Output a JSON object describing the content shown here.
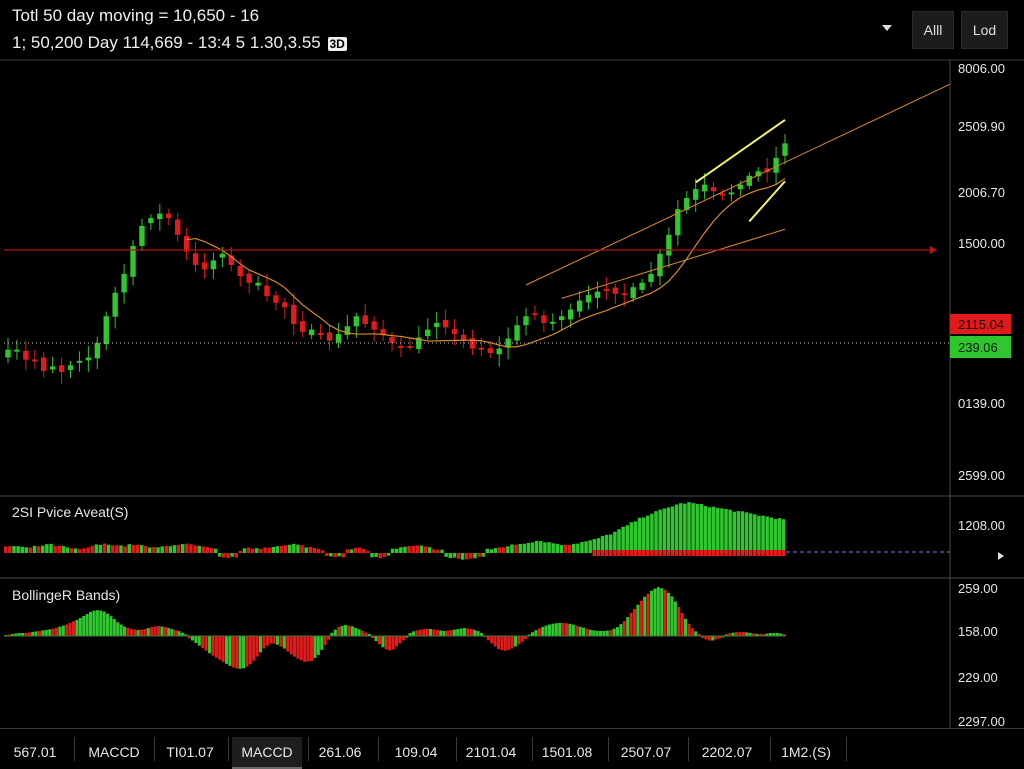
{
  "header": {
    "line1": "Totl 50 day moving = 10,650 - 16",
    "line2": "1; 50,200 Day 114,669 - 13:4 5 1.30,3.55",
    "badge": "3D",
    "buttons": [
      {
        "label": "Alll"
      },
      {
        "label": "Lod"
      }
    ]
  },
  "panels": {
    "rsi_label": "2SI Pvice Aveat(S)",
    "bollinger_label": "BollingeR Bands)"
  },
  "price_axis": {
    "ticks": [
      "8006.00",
      "2509.90",
      "2006.70",
      "1500.00",
      "0139.00",
      "2599.00"
    ],
    "tag_red": "2115.04",
    "tag_green": "239.06"
  },
  "rsi_axis": {
    "ticks": [
      "1208.00"
    ]
  },
  "macd_axis": {
    "ticks": [
      "259.00",
      "158.00",
      "229.00",
      "2297.00"
    ]
  },
  "footer": {
    "tabs": [
      {
        "label": "567.01"
      },
      {
        "label": "MACCD"
      },
      {
        "label": "TI01.07"
      },
      {
        "label": "MACCD",
        "active": true
      },
      {
        "label": "261.06"
      },
      {
        "label": "109.04"
      },
      {
        "label": "2101.04"
      },
      {
        "label": "1501.08"
      },
      {
        "label": "2507.07"
      },
      {
        "label": "2202.07"
      },
      {
        "label": "1M2.(S)"
      }
    ]
  },
  "colors": {
    "up": "#2fc62f",
    "down": "#e01b1b",
    "ma": "#d8892c",
    "trend": "#f4f06a",
    "hline": "#b51414",
    "bg": "#000000",
    "grid": "#3a3a3a"
  },
  "chart_data": {
    "type": "candlestick",
    "price_axis_ticks": [
      8006.0,
      2509.9,
      2006.7,
      1500.0,
      139.0,
      2599.0
    ],
    "horizontal_line_label": "1500.00",
    "last_price_tags": {
      "red": "2115.04",
      "green": "239.06"
    },
    "closes": [
      232,
      232,
      223,
      223,
      213,
      217,
      212,
      218,
      222,
      225,
      238,
      262,
      283,
      300,
      325,
      343,
      350,
      354,
      350,
      335,
      320,
      308,
      304,
      312,
      318,
      308,
      298,
      292,
      292,
      280,
      274,
      270,
      255,
      248,
      250,
      246,
      240,
      246,
      253,
      262,
      255,
      250,
      245,
      238,
      234,
      235,
      243,
      250,
      256,
      252,
      246,
      240,
      233,
      232,
      229,
      233,
      242,
      254,
      262,
      263,
      256,
      257,
      262,
      268,
      276,
      281,
      284,
      285,
      282,
      281,
      288,
      292,
      300,
      318,
      335,
      358,
      368,
      376,
      380,
      374,
      371,
      373,
      380,
      388,
      392,
      391,
      404,
      417
    ],
    "rsi_values": [
      2,
      2,
      1,
      2,
      3,
      2,
      1,
      0,
      2,
      3,
      3,
      2,
      3,
      2,
      1,
      2,
      3,
      3,
      2,
      1,
      0,
      -1,
      0,
      1,
      1,
      2,
      2,
      3,
      2,
      1,
      0,
      -1,
      0,
      1,
      0,
      -1,
      0,
      1,
      2,
      2,
      1,
      0,
      -1,
      -2,
      -1,
      0,
      1,
      2,
      3,
      4,
      5,
      4,
      3,
      3,
      4,
      5,
      7,
      9,
      12,
      15,
      18,
      20,
      22,
      24,
      25,
      24,
      23,
      22,
      21,
      20,
      19,
      18,
      17,
      16
    ],
    "macd_values": [
      0,
      1,
      2,
      2,
      3,
      4,
      5,
      6,
      8,
      10,
      13,
      16,
      20,
      24,
      25,
      23,
      18,
      12,
      8,
      6,
      5,
      6,
      8,
      9,
      8,
      6,
      4,
      1,
      -3,
      -8,
      -13,
      -18,
      -22,
      -26,
      -30,
      -32,
      -31,
      -26,
      -18,
      -10,
      -6,
      -8,
      -12,
      -18,
      -22,
      -25,
      -24,
      -18,
      -8,
      2,
      8,
      10,
      9,
      6,
      3,
      0,
      -6,
      -12,
      -14,
      -8,
      -2,
      3,
      5,
      6,
      6,
      5,
      4,
      5,
      6,
      7,
      6,
      4,
      0,
      -6,
      -12,
      -14,
      -12,
      -8,
      -3,
      2,
      6,
      9,
      11,
      12,
      12,
      11,
      9,
      7,
      5,
      4,
      4,
      5,
      8,
      14,
      22,
      30,
      38,
      44,
      48,
      46,
      40,
      30,
      18,
      8,
      2,
      -2,
      -4,
      -2,
      0,
      2,
      3,
      3,
      2,
      1,
      1,
      2,
      2,
      1
    ],
    "rsi_dashed_line": true,
    "grid": false
  }
}
